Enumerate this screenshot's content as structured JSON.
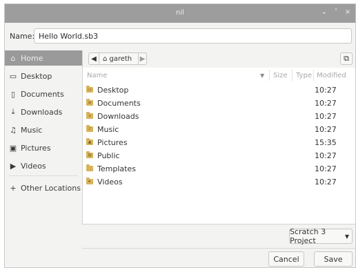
{
  "window": {
    "title": "nil",
    "controls": [
      "⌄",
      "˄",
      "×"
    ]
  },
  "name_row": {
    "label": "Name:",
    "value": "Hello World.sb3"
  },
  "sidebar": {
    "items": [
      {
        "label": "Home",
        "icon": "home-icon",
        "glyph": "⌂",
        "active": true
      },
      {
        "label": "Desktop",
        "icon": "desktop-folder-icon",
        "glyph": "▭",
        "active": false
      },
      {
        "label": "Documents",
        "icon": "documents-icon",
        "glyph": "▯",
        "active": false
      },
      {
        "label": "Downloads",
        "icon": "download-icon",
        "glyph": "⤓",
        "active": false
      },
      {
        "label": "Music",
        "icon": "music-icon",
        "glyph": "♫",
        "active": false
      },
      {
        "label": "Pictures",
        "icon": "pictures-icon",
        "glyph": "▣",
        "active": false
      },
      {
        "label": "Videos",
        "icon": "videos-icon",
        "glyph": "▶",
        "active": false
      },
      {
        "label": "Other Locations",
        "icon": "plus-icon",
        "glyph": "+",
        "active": false
      }
    ]
  },
  "path_bar": {
    "back": "◀",
    "home_glyph": "⌂",
    "crumb": "gareth",
    "forward": "▶",
    "new_folder": "⧉"
  },
  "columns": {
    "name": "Name",
    "size": "Size",
    "type": "Type",
    "modified": "Modified",
    "sort_glyph": "▼"
  },
  "files": [
    {
      "name": "Desktop",
      "modified": "10:27",
      "glyph": "▭"
    },
    {
      "name": "Documents",
      "modified": "10:27",
      "glyph": "≡"
    },
    {
      "name": "Downloads",
      "modified": "10:27",
      "glyph": "↓"
    },
    {
      "name": "Music",
      "modified": "10:27",
      "glyph": "♪"
    },
    {
      "name": "Pictures",
      "modified": "15:35",
      "glyph": "▲"
    },
    {
      "name": "Public",
      "modified": "10:27",
      "glyph": "◍"
    },
    {
      "name": "Templates",
      "modified": "10:27",
      "glyph": ""
    },
    {
      "name": "Videos",
      "modified": "10:27",
      "glyph": "▸"
    }
  ],
  "filter": {
    "label": "Scratch 3 Project",
    "arrow": "▼"
  },
  "buttons": {
    "cancel": "Cancel",
    "save": "Save"
  },
  "colors": {
    "titlebar": "#9d9d9d",
    "active_sidebar": "#9a9a9a",
    "folder": "#d8b35a"
  }
}
